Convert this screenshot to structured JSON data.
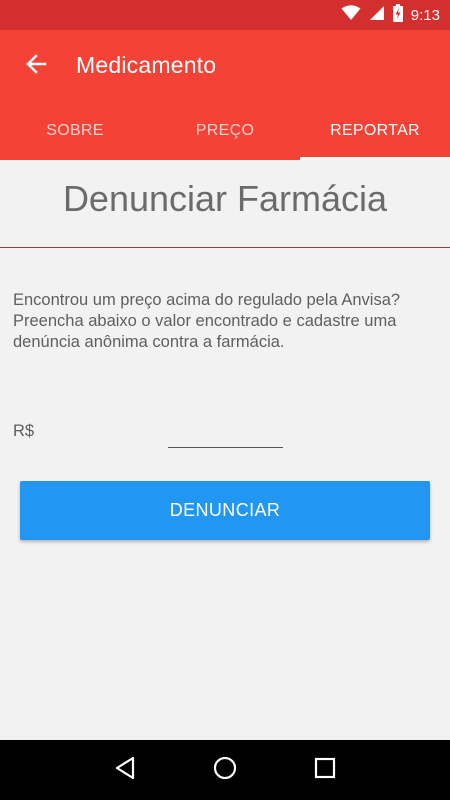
{
  "status_bar": {
    "time": "9:13",
    "icons": [
      "wifi-icon",
      "cellular-signal-icon",
      "battery-charging-icon"
    ]
  },
  "app_bar": {
    "title": "Medicamento",
    "back_icon": "arrow-back-icon"
  },
  "tabs": [
    {
      "label": "SOBRE",
      "active": false
    },
    {
      "label": "PREÇO",
      "active": false
    },
    {
      "label": "REPORTAR",
      "active": true
    }
  ],
  "report": {
    "heading": "Denunciar Farmácia",
    "description": "Encontrou um preço acima do regulado pela Anvisa? Preencha abaixo o valor encontrado e cadastre uma denúncia anônima contra a farmácia.",
    "currency_label": "R$",
    "price_value": "",
    "submit_label": "DENUNCIAR"
  },
  "nav_bar": {
    "icons": [
      "back-triangle-icon",
      "home-circle-icon",
      "recents-square-icon"
    ]
  },
  "colors": {
    "status_bar": "#d32f2f",
    "app_bar": "#f44336",
    "button": "#2196f3",
    "background": "#f2f2f2"
  }
}
